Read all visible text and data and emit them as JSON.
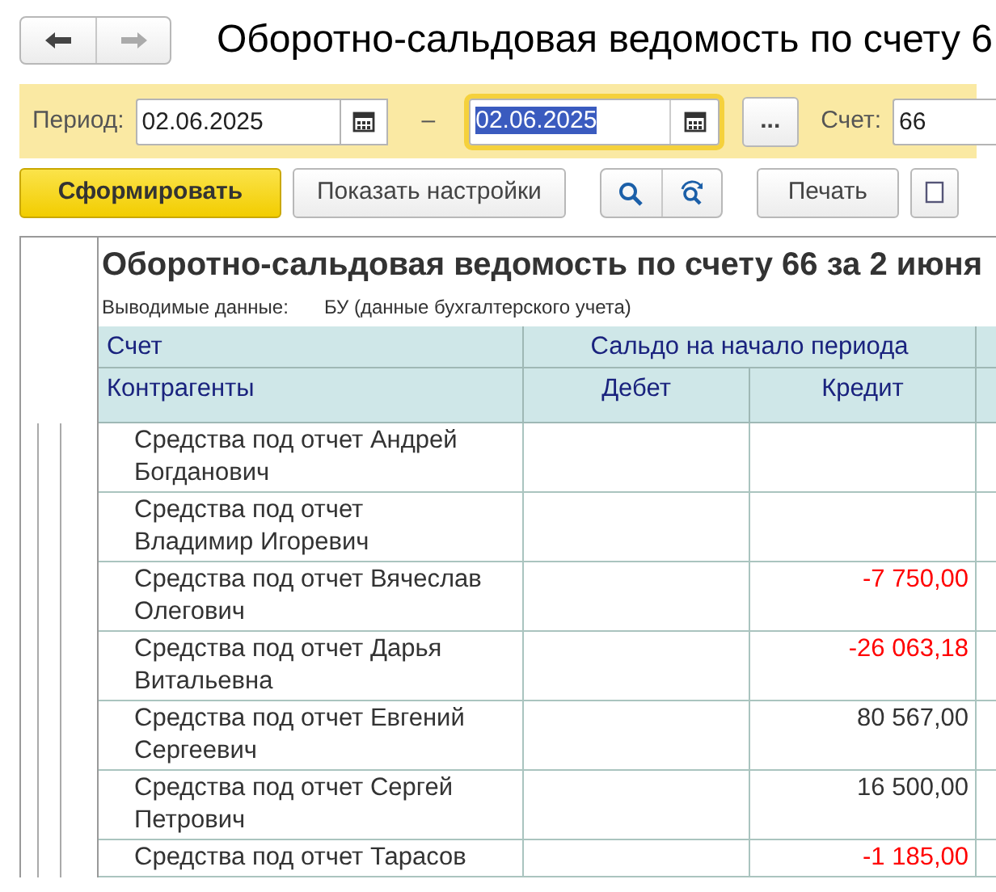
{
  "window": {
    "title": "Оборотно-сальдовая ведомость по счету 6"
  },
  "filter": {
    "period_label": "Период:",
    "date_from": "02.06.2025",
    "separator": "–",
    "date_to": "02.06.2025",
    "more_button": "...",
    "account_label": "Счет:",
    "account": "66"
  },
  "toolbar": {
    "generate_button": "Сформировать",
    "settings_button": "Показать настройки",
    "print_button": "Печать"
  },
  "report": {
    "title": "Оборотно-сальдовая ведомость по счету 66 за 2 июня",
    "output_label": "Выводимые данные:",
    "output_value": "БУ (данные бухгалтерского учета)",
    "header": {
      "account": "Счет",
      "opening_balance": "Сальдо на начало периода",
      "counterparties": "Контрагенты",
      "debit": "Дебет",
      "credit": "Кредит"
    },
    "rows": [
      {
        "name": "Средства под отчет Андрей Богданович"
      },
      {
        "name": "Средства под отчет Владимир Игоревич"
      },
      {
        "name": "Средства под отчет Вячеслав Олегович",
        "credit": "-7 750,00",
        "negative": true
      },
      {
        "name": "Средства под отчет Дарья Витальевна",
        "credit": "-26 063,18",
        "negative": true
      },
      {
        "name": "Средства под отчет Евгений Сергеевич",
        "credit": "80 567,00",
        "negative": false
      },
      {
        "name": "Средства под отчет Сергей Петрович",
        "credit": "16 500,00",
        "negative": false
      },
      {
        "name": "Средства под отчет Тарасов",
        "credit": "-1 185,00",
        "negative": true
      }
    ]
  }
}
